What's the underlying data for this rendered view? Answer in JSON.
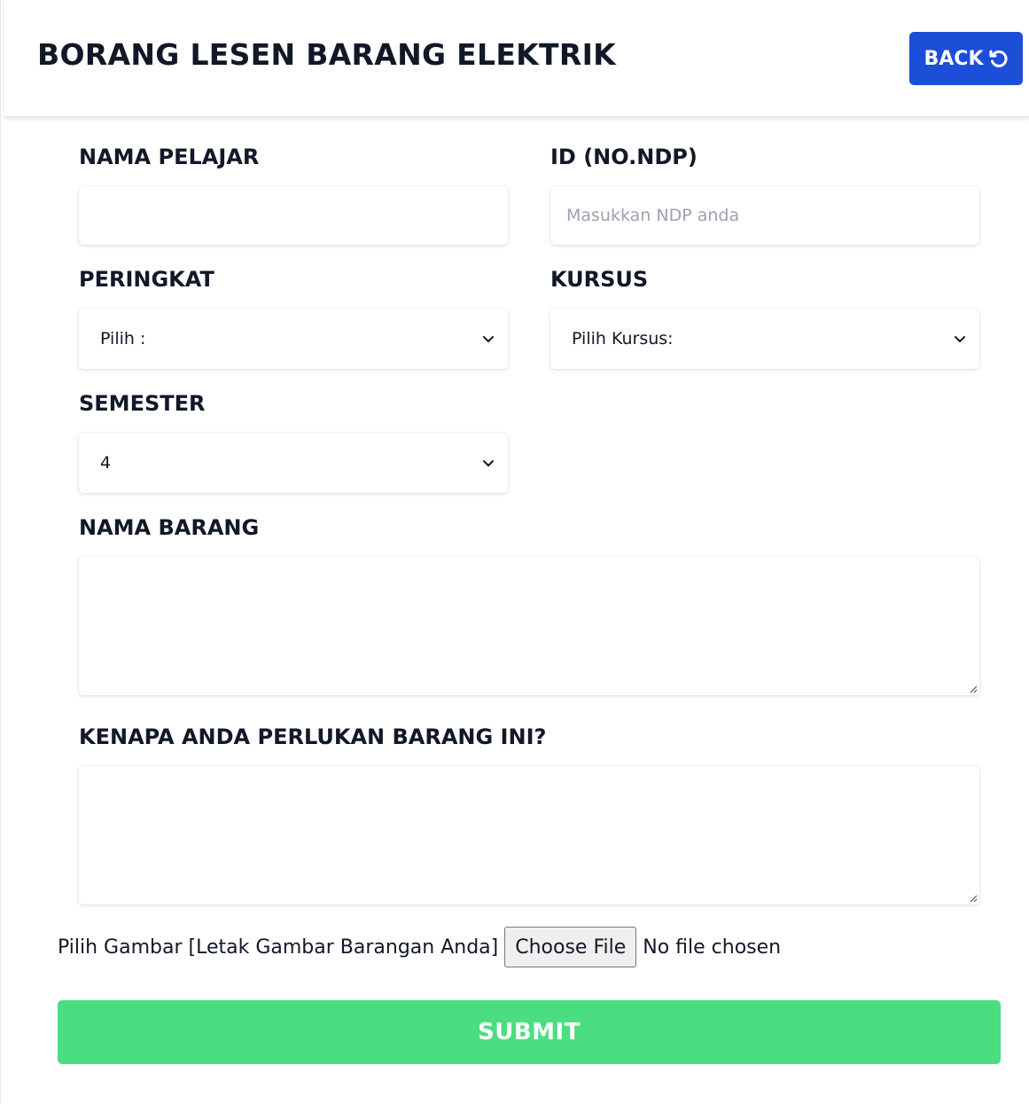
{
  "header": {
    "title": "BORANG LESEN BARANG ELEKTRIK",
    "back_label": "BACK"
  },
  "form": {
    "nama_pelajar": {
      "label": "NAMA PELAJAR",
      "value": "",
      "placeholder": ""
    },
    "id_ndp": {
      "label": "ID (NO.NDP)",
      "value": "",
      "placeholder": "Masukkan NDP anda"
    },
    "peringkat": {
      "label": "PERINGKAT",
      "selected": "Pilih :"
    },
    "kursus": {
      "label": "KURSUS",
      "selected": "Pilih Kursus:"
    },
    "semester": {
      "label": "SEMESTER",
      "selected": "4"
    },
    "nama_barang": {
      "label": "NAMA BARANG",
      "value": ""
    },
    "kenapa": {
      "label": "KENAPA ANDA PERLUKAN BARANG INI?",
      "value": ""
    },
    "file": {
      "label": "Pilih Gambar [Letak Gambar Barangan Anda]",
      "button": "Choose File",
      "status": "No file chosen"
    },
    "submit_label": "SUBMIT"
  },
  "colors": {
    "back_button": "#1d4ed8",
    "submit_button": "#4ade80"
  },
  "icons": {
    "back": "rotate-ccw-icon",
    "select": "chevron-down-icon",
    "resize": "resize-handle-icon"
  }
}
